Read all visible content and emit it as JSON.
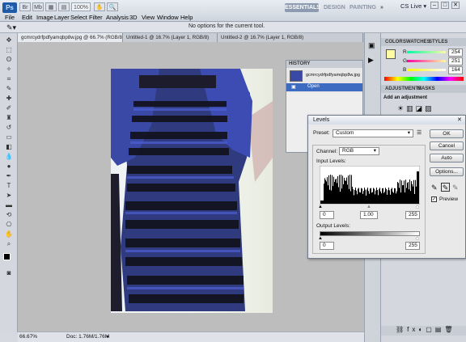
{
  "app": {
    "logo": "Ps",
    "zoom": "100%"
  },
  "menu": [
    "File",
    "Edit",
    "Image",
    "Layer",
    "Select",
    "Filter",
    "Analysis",
    "3D",
    "View",
    "Window",
    "Help"
  ],
  "workspaces": [
    "ESSENTIALS",
    "DESIGN",
    "PAINTING"
  ],
  "cs_live": "CS Live",
  "window_controls": [
    "–",
    "□",
    "✕"
  ],
  "options_message": "No options for the current tool.",
  "tabs": [
    "gcmrcydrfpdfyamqbp8w.jpg @ 66.7% (RGB/8)",
    "Untitled-1 @ 16.7% (Layer 1, RGB/8)",
    "Untitled-2 @ 16.7% (Layer 1, RGB/8)"
  ],
  "status": {
    "zoom": "66.67%",
    "doc": "Doc: 1.76M/1.76M"
  },
  "history": {
    "title": "HISTORY",
    "snapshot": "gcmrcydrfpdfyamqbp8w.jpg",
    "item": "Open"
  },
  "color_panel": {
    "tabs": [
      "COLOR",
      "SWATCHES",
      "STYLES"
    ],
    "channels": [
      {
        "label": "R",
        "value": "254"
      },
      {
        "label": "G",
        "value": "251"
      },
      {
        "label": "B",
        "value": "164"
      }
    ]
  },
  "adjust_panel": {
    "tabs": [
      "ADJUSTMENTS",
      "MASKS"
    ],
    "hint": "Add an adjustment"
  },
  "levels": {
    "title": "Levels",
    "preset_label": "Preset:",
    "preset_value": "Custom",
    "channel_label": "Channel:",
    "channel_value": "RGB",
    "input_label": "Input Levels:",
    "input_values": [
      "0",
      "1.00",
      "255"
    ],
    "output_label": "Output Levels:",
    "output_values": [
      "0",
      "255"
    ],
    "buttons": {
      "ok": "OK",
      "cancel": "Cancel",
      "auto": "Auto",
      "options": "Options..."
    },
    "preview_label": "Preview"
  }
}
